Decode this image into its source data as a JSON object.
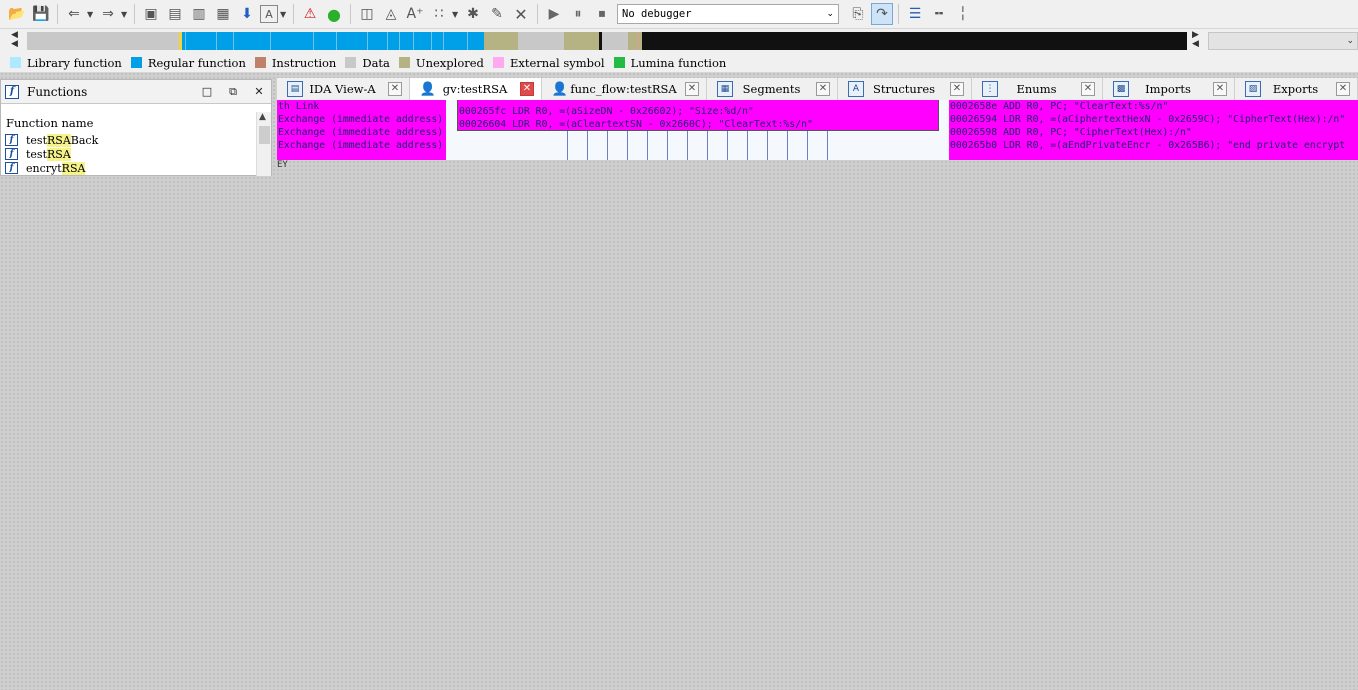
{
  "toolbar": {
    "debugger_select": "No debugger",
    "icons": [
      "open-folder-icon",
      "save-icon",
      "back-arrow-icon",
      "forward-arrow-icon",
      "binoculars-icon",
      "binoculars-text-icon",
      "binoculars-bytes-icon",
      "binoculars-next-icon",
      "jump-down-icon",
      "text-a-icon",
      "stop-warning-icon",
      "green-run-icon",
      "hex-add-icon",
      "hex-edit-icon",
      "text-cursor-icon",
      "patch-icon",
      "gear-plus-icon",
      "pencil-icon",
      "close-x-icon",
      "play-icon",
      "pause-icon",
      "stop-icon",
      "debug-c-icon",
      "debug-step-icon",
      "list-icon",
      "add-breakpoint-icon",
      "remove-breakpoint-icon"
    ]
  },
  "navband": {
    "segments": [
      {
        "color": "#c8c8c8",
        "w": 152
      },
      {
        "color": "#f7d23a",
        "w": 3
      },
      {
        "color": "#00a0e9",
        "w": 302
      },
      {
        "color": "#b5b383",
        "w": 34
      },
      {
        "color": "#c8c8c8",
        "w": 46
      },
      {
        "color": "#b5b383",
        "w": 35
      },
      {
        "color": "#111111",
        "w": 3
      },
      {
        "color": "#c8c8c8",
        "w": 26
      },
      {
        "color": "#b5b383",
        "w": 8
      },
      {
        "color": "#c8a98a",
        "w": 3
      },
      {
        "color": "#b5b383",
        "w": 3
      },
      {
        "color": "#111111",
        "w": 545
      }
    ]
  },
  "legend": [
    {
      "label": "Library function",
      "color": "#aeeaff"
    },
    {
      "label": "Regular function",
      "color": "#00a0e9"
    },
    {
      "label": "Instruction",
      "color": "#c0816a"
    },
    {
      "label": "Data",
      "color": "#c8c8c8"
    },
    {
      "label": "Unexplored",
      "color": "#b5b383"
    },
    {
      "label": "External symbol",
      "color": "#ffaaf0"
    },
    {
      "label": "Lumina function",
      "color": "#22bb44"
    }
  ],
  "functions_panel": {
    "title": "Functions",
    "column_header": "Function name",
    "items": [
      {
        "pre": "test",
        "hl": "RSA",
        "post": "Back"
      },
      {
        "pre": "test",
        "hl": "RSA",
        "post": ""
      },
      {
        "pre": "encryt",
        "hl": "RSA",
        "post": ""
      }
    ]
  },
  "tabs": [
    {
      "label": "IDA View-A",
      "icon": "ida-view-icon",
      "close": "normal",
      "active": false,
      "w": 133
    },
    {
      "label": "gv:testRSA",
      "icon": "person-avatar-icon",
      "close": "red",
      "active": true,
      "w": 132
    },
    {
      "label": "func_flow:testRSA",
      "icon": "person-avatar-icon",
      "close": "normal",
      "active": false,
      "w": 165
    },
    {
      "label": "Segments",
      "icon": "segments-icon",
      "close": "normal",
      "active": false,
      "w": 131
    },
    {
      "label": "Structures",
      "icon": "structures-icon",
      "close": "normal",
      "active": false,
      "w": 134
    },
    {
      "label": "Enums",
      "icon": "enums-icon",
      "close": "normal",
      "active": false,
      "w": 131
    },
    {
      "label": "Imports",
      "icon": "imports-icon",
      "close": "normal",
      "active": false,
      "w": 132
    },
    {
      "label": "Exports",
      "icon": "exports-icon",
      "close": "normal",
      "active": false,
      "w": 123
    }
  ],
  "graph": {
    "left_block": [
      "th Link",
      "Exchange (immediate address)",
      "Exchange (immediate address)",
      "Exchange (immediate address)"
    ],
    "center_block": [
      "000265fc LDR R0, =(aSizeDN - 0x26602); \"Size:%d/n\"",
      "00026604 LDR R0, =(aCleartextSN - 0x2660C); \"ClearText:%s/n\""
    ],
    "right_block": [
      "0002658e ADD R0, PC; \"ClearText:%s/n\"",
      "00026594 LDR R0, =(aCiphertextHexN - 0x2659C); \"CipherText(Hex):/n\"",
      "00026598 ADD R0, PC; \"CipherText(Hex):/n\"",
      "000265b0 LDR R0, =(aEndPrivateEncr - 0x265B6); \"end private encrypt"
    ],
    "bottom_marker": "EY"
  }
}
